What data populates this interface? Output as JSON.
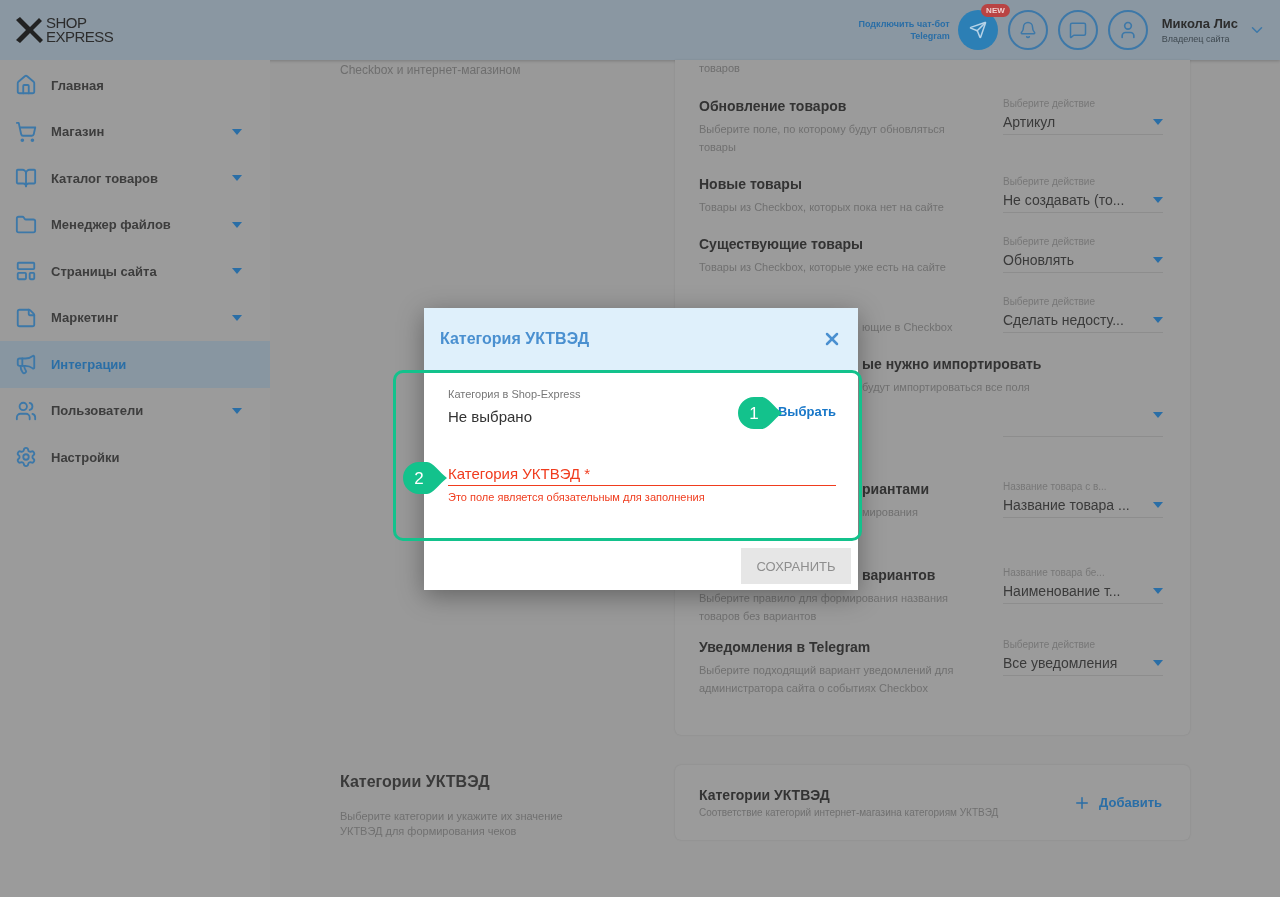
{
  "header": {
    "logo": [
      "SHOP",
      "EXPRESS"
    ],
    "bot_link": [
      "Подключить чат-бот",
      "Telegram"
    ],
    "telegram_badge": "NEW",
    "user": {
      "name": "Микола Лис",
      "role": "Владелец сайта"
    }
  },
  "sidebar": {
    "items": [
      {
        "label": "Главная",
        "selected": false,
        "expandable": false
      },
      {
        "label": "Магазин",
        "selected": false,
        "expandable": true
      },
      {
        "label": "Каталог товаров",
        "selected": false,
        "expandable": true
      },
      {
        "label": "Менеджер файлов",
        "selected": false,
        "expandable": true
      },
      {
        "label": "Страницы сайта",
        "selected": false,
        "expandable": true
      },
      {
        "label": "Маркетинг",
        "selected": false,
        "expandable": true
      },
      {
        "label": "Интеграции",
        "selected": true,
        "expandable": false
      },
      {
        "label": "Пользователи",
        "selected": false,
        "expandable": true
      },
      {
        "label": "Настройки",
        "selected": false,
        "expandable": false
      }
    ]
  },
  "settings": {
    "intro": "Checkbox и интернет-магазином",
    "top_text": "товаров",
    "rows": [
      {
        "kind": "full",
        "title": "Обновление товаров",
        "description": "Выберите поле, по которому будут обновляться товары",
        "select": {
          "label": "Выберите действие",
          "value": "Артикул"
        }
      },
      {
        "kind": "full",
        "title": "Новые товары",
        "description": "Товары из Checkbox, которых пока нет на сайте",
        "select": {
          "label": "Выберите действие",
          "value": "Не создавать (то..."
        }
      },
      {
        "kind": "full",
        "title": "Существующие товары",
        "description": "Товары из Checkbox, которые уже есть на сайте",
        "select": {
          "label": "Выберите действие",
          "value": "Обновлять"
        }
      },
      {
        "kind": "clipped",
        "description": "ющие в Checkbox",
        "select": {
          "label": "Выберите действие",
          "value": "Сделать недосту..."
        }
      },
      {
        "kind": "clipped",
        "title": "ые нужно импортировать",
        "description": "будут импортироваться все поля",
        "select": {}
      },
      {
        "kind": "clipped",
        "title": "риантами",
        "description": "мирования",
        "select": {
          "label": "Название товара с в...",
          "value": "Название товара ..."
        }
      },
      {
        "kind": "title-clipped",
        "title": "вариантов",
        "description": "Выберите правило для формирования названия товаров без вариантов",
        "select": {
          "label": "Название товара бе...",
          "value": "Наименование т..."
        }
      },
      {
        "kind": "full",
        "title": "Уведомления в Telegram",
        "description": "Выберите подходящий вариант уведомлений для администратора сайта о событиях Checkbox",
        "select": {
          "label": "Выберите действие",
          "value": "Все уведомления"
        }
      }
    ]
  },
  "categories": {
    "heading": "Категории УКТВЭД",
    "description": "Выберите категории и укажите их значение УКТВЭД для формирования чеков",
    "card_title": "Категории УКТВЭД",
    "card_description": "Соответствие категорий интернет-магазина категориям УКТВЭД",
    "add_button": "Добавить"
  },
  "dialog": {
    "title": "Категория УКТВЭД",
    "source_label": "Категория в Shop-Express",
    "source_value": "Не выбрано",
    "choose_link": "Выбрать",
    "field": {
      "label": "Категория УКТВЭД *",
      "error": "Это поле является обязательным для заполнения"
    },
    "save_button": {
      "label": "СОХРАНИТЬ",
      "disabled": true
    }
  },
  "annotations": [
    "1",
    "2"
  ]
}
